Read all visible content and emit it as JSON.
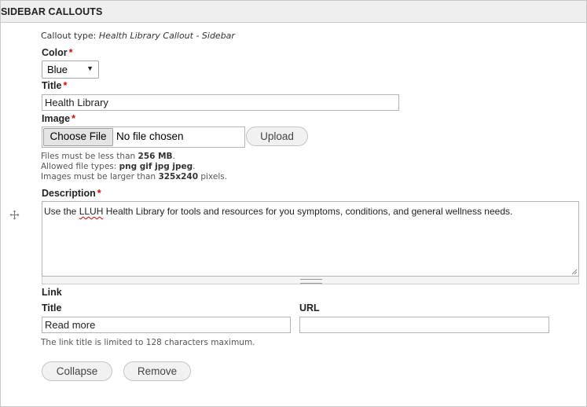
{
  "header": {
    "title": "SIDEBAR CALLOUTS"
  },
  "callout_type": {
    "label": "Callout type:",
    "value": "Health Library Callout - Sidebar"
  },
  "color": {
    "label": "Color",
    "required_mark": "*",
    "selected": "Blue",
    "arrow_icon": "triangle-down"
  },
  "title_field": {
    "label": "Title",
    "required_mark": "*",
    "value": "Health Library"
  },
  "image": {
    "label": "Image",
    "required_mark": "*",
    "choose_label": "Choose File",
    "file_status": "No file chosen",
    "upload_label": "Upload",
    "help": {
      "size_prefix": "Files must be less than ",
      "size_value": "256 MB",
      "size_suffix": ".",
      "types_prefix": "Allowed file types: ",
      "types_value": "png gif jpg jpeg",
      "types_suffix": ".",
      "dims_prefix": "Images must be larger than ",
      "dims_value": "325x240",
      "dims_suffix": " pixels."
    }
  },
  "description": {
    "label": "Description",
    "required_mark": "*",
    "text_before": "Use the ",
    "text_misspelled": "LLUH",
    "text_after": " Health Library for tools and resources for you symptoms, conditions, and general wellness needs."
  },
  "link": {
    "section_label": "Link",
    "title_label": "Title",
    "title_value": "Read more",
    "url_label": "URL",
    "url_value": "",
    "help": "The link title is limited to 128 characters maximum."
  },
  "actions": {
    "collapse_label": "Collapse",
    "remove_label": "Remove"
  },
  "colors": {
    "required": "#e00707",
    "header_bg": "#efefef",
    "button_bg": "#f1f1f1"
  },
  "icons": {
    "drag": "move-arrows-icon",
    "resize": "resize-grip-icon"
  }
}
